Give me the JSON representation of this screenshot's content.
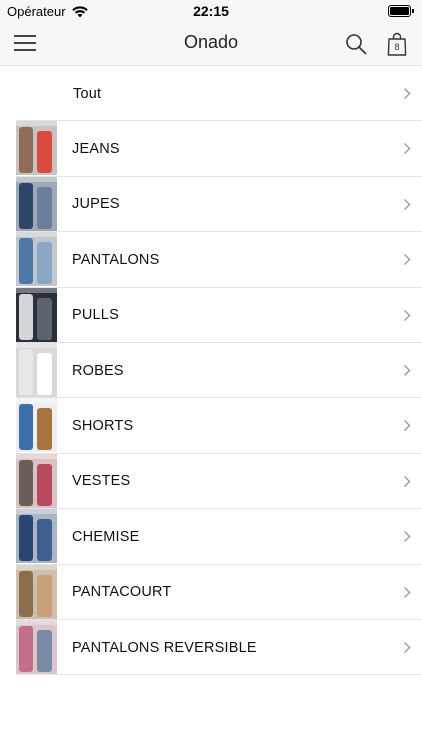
{
  "status_bar": {
    "carrier": "Opérateur",
    "time": "22:15"
  },
  "nav": {
    "title": "Onado",
    "bag_count": "8"
  },
  "categories": [
    {
      "label": "Tout",
      "has_image": false
    },
    {
      "label": "JEANS",
      "has_image": true,
      "colors": [
        "#c7c3c0",
        "#8e6e5b",
        "#d94b3e"
      ]
    },
    {
      "label": "JUPES",
      "has_image": true,
      "colors": [
        "#9fa9b5",
        "#2f4668",
        "#6a7f99"
      ]
    },
    {
      "label": "PANTALONS",
      "has_image": true,
      "colors": [
        "#c2c7cb",
        "#4e78a8",
        "#8aa6c4"
      ]
    },
    {
      "label": "PULLS",
      "has_image": true,
      "colors": [
        "#2a2f3a",
        "#d3d5d8",
        "#5d6470"
      ]
    },
    {
      "label": "ROBES",
      "has_image": true,
      "colors": [
        "#d9d9d9",
        "#e8e8e8",
        "#ffffff"
      ]
    },
    {
      "label": "SHORTS",
      "has_image": true,
      "colors": [
        "#eeeeee",
        "#3b6fa9",
        "#a7743f"
      ]
    },
    {
      "label": "VESTES",
      "has_image": true,
      "colors": [
        "#d8c2c6",
        "#6b5e57",
        "#b74a61"
      ]
    },
    {
      "label": "CHEMISE",
      "has_image": true,
      "colors": [
        "#a9b6c3",
        "#2b4470",
        "#3f5f8e"
      ]
    },
    {
      "label": "PANTACOURT",
      "has_image": true,
      "colors": [
        "#cdbfae",
        "#8b6f4d",
        "#c9a07c"
      ]
    },
    {
      "label": "PANTALONS REVERSIBLE",
      "has_image": true,
      "colors": [
        "#d8c6cb",
        "#c46f8a",
        "#7a8aa3"
      ]
    }
  ]
}
